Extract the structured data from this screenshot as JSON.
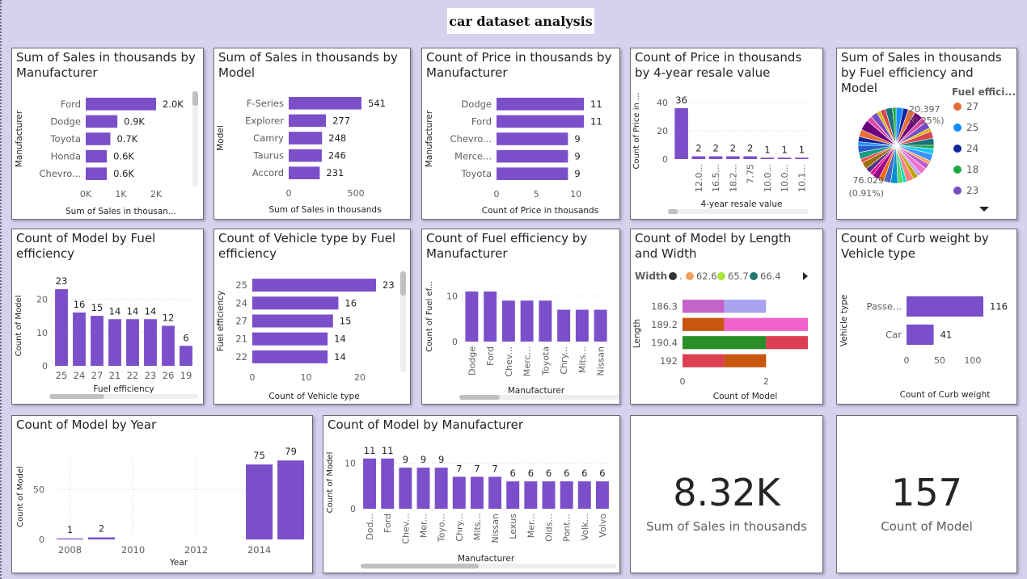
{
  "page_title": "car dataset analysis",
  "colors": {
    "bar": "#7b4fc9",
    "axis": "#605e5c",
    "label": "#252423",
    "grid": "#d0d0d0",
    "scroll": "#c8c8c8"
  },
  "chart_data": [
    {
      "id": "c1",
      "type": "bar",
      "orientation": "horizontal",
      "title": "Sum of Sales in thousands by Manufacturer",
      "categories": [
        "Ford",
        "Dodge",
        "Toyota",
        "Honda",
        "Chevro..."
      ],
      "values": [
        2000,
        900,
        700,
        600,
        600
      ],
      "value_labels": [
        "2.0K",
        "0.9K",
        "0.7K",
        "0.6K",
        "0.6K"
      ],
      "xlim": [
        0,
        2000
      ],
      "x_ticks": [
        0,
        1000,
        2000
      ],
      "x_tick_labels": [
        "0K",
        "1K",
        "2K"
      ],
      "xlabel": "Sum of Sales in thousan...",
      "ylabel": "Manufacturer"
    },
    {
      "id": "c2",
      "type": "bar",
      "orientation": "horizontal",
      "title": "Sum of Sales in thousands by Model",
      "categories": [
        "F-Series",
        "Explorer",
        "Camry",
        "Taurus",
        "Accord"
      ],
      "values": [
        541,
        277,
        248,
        246,
        231
      ],
      "value_labels": [
        "541",
        "277",
        "248",
        "246",
        "231"
      ],
      "xlim": [
        0,
        541
      ],
      "x_ticks": [
        0,
        500
      ],
      "x_tick_labels": [
        "0",
        "500"
      ],
      "xlabel": "Sum of Sales in thousands",
      "ylabel": "Model"
    },
    {
      "id": "c3",
      "type": "bar",
      "orientation": "horizontal",
      "title": "Count of Price in thousands by Manufacturer",
      "categories": [
        "Dodge",
        "Ford",
        "Chevro...",
        "Merce...",
        "Toyota"
      ],
      "values": [
        11,
        11,
        9,
        9,
        9
      ],
      "value_labels": [
        "11",
        "11",
        "9",
        "9",
        "9"
      ],
      "xlim": [
        0,
        11
      ],
      "x_ticks": [
        0,
        5,
        10
      ],
      "x_tick_labels": [
        "0",
        "5",
        "10"
      ],
      "xlabel": "Count of Price in thousands",
      "ylabel": "Manufacturer"
    },
    {
      "id": "c4",
      "type": "bar",
      "orientation": "vertical",
      "title": "Count of Price in thousands by 4-year resale value",
      "categories": [
        "12.0...",
        "16.5...",
        "18.2...",
        "7.75",
        "10.0...",
        "10.0...",
        "10.1..."
      ],
      "leading_category": "",
      "values": [
        36,
        2,
        2,
        2,
        2,
        1,
        1,
        1
      ],
      "value_labels": [
        "36",
        "2",
        "2",
        "2",
        "2",
        "1",
        "1",
        "1"
      ],
      "ylim": [
        0,
        40
      ],
      "y_ticks": [
        0,
        20,
        40
      ],
      "y_tick_labels": [
        "0",
        "20",
        "40"
      ],
      "xlabel": "4-year resale value",
      "ylabel": "Count of Price in ..."
    },
    {
      "id": "c5",
      "type": "pie",
      "title": "Sum of Sales in thousands by Fuel efficiency and Model",
      "legend_title": "Fuel effici...",
      "legend": [
        {
          "name": "27",
          "color": "#e66c37"
        },
        {
          "name": "25",
          "color": "#118dff"
        },
        {
          "name": "24",
          "color": "#12239e"
        },
        {
          "name": "18",
          "color": "#1aab40"
        },
        {
          "name": "23",
          "color": "#744ec2"
        }
      ],
      "annotations": [
        {
          "value": "20.397",
          "pct": "(0.25%)"
        },
        {
          "value": "76.029",
          "pct": "(0.91%)"
        }
      ]
    },
    {
      "id": "c6",
      "type": "bar",
      "orientation": "vertical",
      "title": "Count of Model by Fuel efficiency",
      "categories": [
        "25",
        "24",
        "27",
        "21",
        "22",
        "23",
        "26",
        "19"
      ],
      "values": [
        23,
        16,
        15,
        14,
        14,
        14,
        12,
        6
      ],
      "value_labels": [
        "23",
        "16",
        "15",
        "14",
        "14",
        "14",
        "12",
        "6"
      ],
      "ylim": [
        0,
        24
      ],
      "y_ticks": [
        0,
        10,
        20
      ],
      "y_tick_labels": [
        "0",
        "10",
        "20"
      ],
      "xlabel": "Fuel efficiency",
      "ylabel": "Count of Model"
    },
    {
      "id": "c7",
      "type": "bar",
      "orientation": "horizontal",
      "title": "Count of Vehicle type by Fuel efficiency",
      "categories": [
        "25",
        "24",
        "27",
        "21",
        "22"
      ],
      "values": [
        23,
        16,
        15,
        14,
        14
      ],
      "value_labels": [
        "23",
        "16",
        "15",
        "14",
        "14"
      ],
      "xlim": [
        0,
        23
      ],
      "x_ticks": [
        0,
        10,
        20
      ],
      "x_tick_labels": [
        "0",
        "10",
        "20"
      ],
      "xlabel": "Count of Vehicle type",
      "ylabel": "Fuel efficiency"
    },
    {
      "id": "c8",
      "type": "bar",
      "orientation": "vertical",
      "title": "Count of Fuel efficiency by Manufacturer",
      "categories": [
        "Dodge",
        "Ford",
        "Chev...",
        "Merc...",
        "Toyota",
        "Chry...",
        "Mits...",
        "Nissan"
      ],
      "values": [
        11,
        11,
        9,
        9,
        9,
        7,
        7,
        7
      ],
      "value_labels": [],
      "ylim": [
        0,
        11
      ],
      "y_ticks": [
        0,
        10
      ],
      "y_tick_labels": [
        "0",
        "10"
      ],
      "xlabel": "Manufacturer",
      "ylabel": "Count of Fuel ef..."
    },
    {
      "id": "c9",
      "type": "bar",
      "orientation": "horizontal",
      "stacked": true,
      "title": "Count of Model by Length and Width",
      "legend_title": "Width",
      "legend": [
        {
          "name": ".",
          "color": "#333333"
        },
        {
          "name": "62.6",
          "color": "#f2a15c"
        },
        {
          "name": "65.7",
          "color": "#a8e639"
        },
        {
          "name": "66.4",
          "color": "#1f7a70"
        }
      ],
      "categories": [
        "186.3",
        "189.2",
        "190.4",
        "192"
      ],
      "segments": [
        [
          {
            "value": 1,
            "color": "#c463c9"
          },
          {
            "value": 1,
            "color": "#a9a3f0"
          }
        ],
        [
          {
            "value": 1,
            "color": "#c9560f"
          },
          {
            "value": 2,
            "color": "#f062cc"
          }
        ],
        [
          {
            "value": 2,
            "color": "#2a8f2a"
          },
          {
            "value": 1,
            "color": "#dc3f52"
          }
        ],
        [
          {
            "value": 1,
            "color": "#dc3f52"
          },
          {
            "value": 1,
            "color": "#c9560f"
          }
        ]
      ],
      "xlim": [
        0,
        3
      ],
      "x_ticks": [
        0,
        2
      ],
      "x_tick_labels": [
        "0",
        "2"
      ],
      "xlabel": "Count of Model",
      "ylabel": "Length"
    },
    {
      "id": "c10",
      "type": "bar",
      "orientation": "horizontal",
      "title": "Count of Curb weight by Vehicle type",
      "categories": [
        "Passe...",
        "Car"
      ],
      "values": [
        116,
        41
      ],
      "value_labels": [
        "116",
        "41"
      ],
      "xlim": [
        0,
        116
      ],
      "x_ticks": [
        0,
        50,
        100
      ],
      "x_tick_labels": [
        "0",
        "50",
        "100"
      ],
      "xlabel": "Count of Curb weight",
      "ylabel": "Vehicle type"
    },
    {
      "id": "c11",
      "type": "bar",
      "orientation": "vertical",
      "title": "Count of Model by Year",
      "x": [
        2008,
        2009,
        2014,
        2015
      ],
      "values": [
        1,
        2,
        75,
        79
      ],
      "value_labels": [
        "1",
        "2",
        "75",
        "79"
      ],
      "xlim": [
        2007.5,
        2015.6
      ],
      "x_ticks": [
        2008,
        2010,
        2012,
        2014
      ],
      "x_tick_labels": [
        "2008",
        "2010",
        "2012",
        "2014"
      ],
      "ylim": [
        0,
        80
      ],
      "y_ticks": [
        0,
        50
      ],
      "y_tick_labels": [
        "0",
        "50"
      ],
      "xlabel": "Year",
      "ylabel": "Count of Model"
    },
    {
      "id": "c12",
      "type": "bar",
      "orientation": "vertical",
      "title": "Count of Model by Manufacturer",
      "categories": [
        "Dod...",
        "Ford",
        "Chev...",
        "Mer...",
        "Toyo...",
        "Chry...",
        "Mits...",
        "Nissan",
        "Lexus",
        "Mer...",
        "Olds...",
        "Pont...",
        "Volk...",
        "Volvo"
      ],
      "values": [
        11,
        11,
        9,
        9,
        9,
        7,
        7,
        7,
        6,
        6,
        6,
        6,
        6,
        6
      ],
      "value_labels": [
        "11",
        "11",
        "9",
        "9",
        "9",
        "7",
        "7",
        "7",
        "6",
        "6",
        "6",
        "6",
        "6",
        "6"
      ],
      "ylim": [
        0,
        11.5
      ],
      "y_ticks": [
        0,
        10
      ],
      "y_tick_labels": [
        "0",
        "10"
      ],
      "xlabel": "Manufacturer",
      "ylabel": "Count of Model"
    }
  ],
  "kpis": [
    {
      "value": "8.32K",
      "label": "Sum of Sales in thousands"
    },
    {
      "value": "157",
      "label": "Count of Model"
    }
  ]
}
